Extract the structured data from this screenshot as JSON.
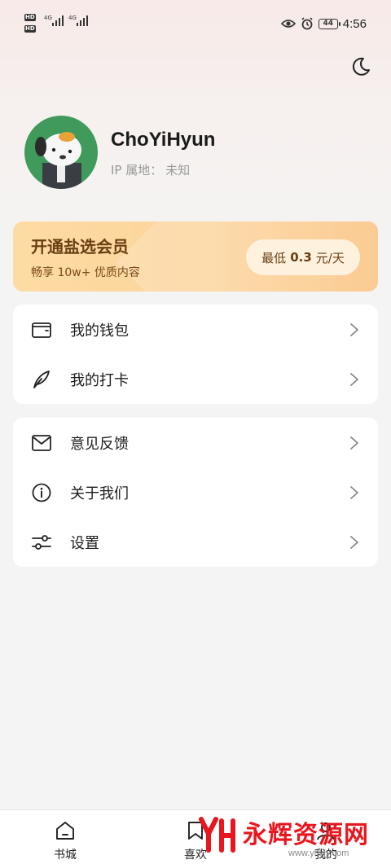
{
  "status_bar": {
    "hd1": "HD",
    "hd2": "HD",
    "net1": "4G",
    "net2": "4G",
    "time": "4:56",
    "battery": "44"
  },
  "profile": {
    "username": "ChoYiHyun",
    "ip_label": "IP 属地：",
    "ip_value": "未知"
  },
  "vip": {
    "title": "开通盐选会员",
    "subtitle": "畅享 10w+ 优质内容",
    "btn_prefix": "最低",
    "btn_price": "0.3",
    "btn_unit": "元/天"
  },
  "menu_group1": [
    {
      "label": "我的钱包",
      "icon": "wallet-icon"
    },
    {
      "label": "我的打卡",
      "icon": "feather-icon"
    }
  ],
  "menu_group2": [
    {
      "label": "意见反馈",
      "icon": "mail-icon"
    },
    {
      "label": "关于我们",
      "icon": "info-icon"
    },
    {
      "label": "设置",
      "icon": "sliders-icon"
    }
  ],
  "bottom_nav": [
    {
      "label": "书城",
      "icon": "home-icon"
    },
    {
      "label": "喜欢",
      "icon": "bookmark-icon"
    },
    {
      "label": "我的",
      "icon": "profile-icon"
    }
  ],
  "watermark": {
    "logo": "YH",
    "text": "永辉资源网",
    "url": "www.yhkjy.com"
  },
  "colors": {
    "accent_brown": "#6a3e12",
    "vip_gradient_start": "#fddca4",
    "vip_gradient_end": "#fbc07b",
    "watermark_red": "#e8161e"
  }
}
